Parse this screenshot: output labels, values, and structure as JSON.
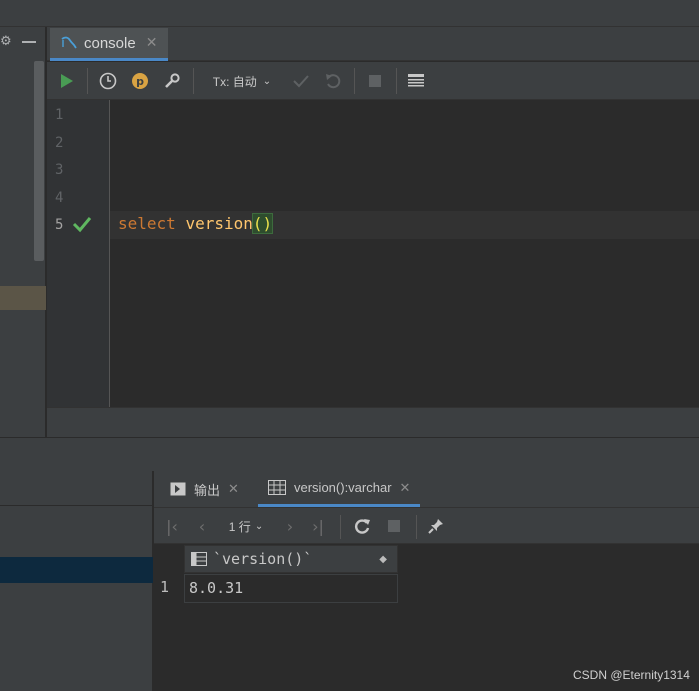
{
  "editor_tab": {
    "label": "console"
  },
  "toolbar": {
    "tx_label": "Tx: 自动"
  },
  "editor": {
    "line_numbers": [
      "1",
      "2",
      "3",
      "4",
      "5"
    ],
    "code": {
      "keyword": "select",
      "function": "version",
      "parens": "()"
    }
  },
  "services": {
    "tabs": [
      {
        "label": "输出"
      },
      {
        "label": "version():varchar"
      }
    ],
    "rows_label": "1 行"
  },
  "result": {
    "column_header": "`version()`",
    "rows": [
      {
        "num": "1",
        "value": "8.0.31"
      }
    ]
  },
  "watermark": "CSDN @Eternity1314",
  "colors": {
    "keyword": "#cc7832",
    "function": "#ffc66d",
    "accent": "#4a88c7",
    "run_green": "#499c54",
    "check_green": "#5fb760"
  }
}
